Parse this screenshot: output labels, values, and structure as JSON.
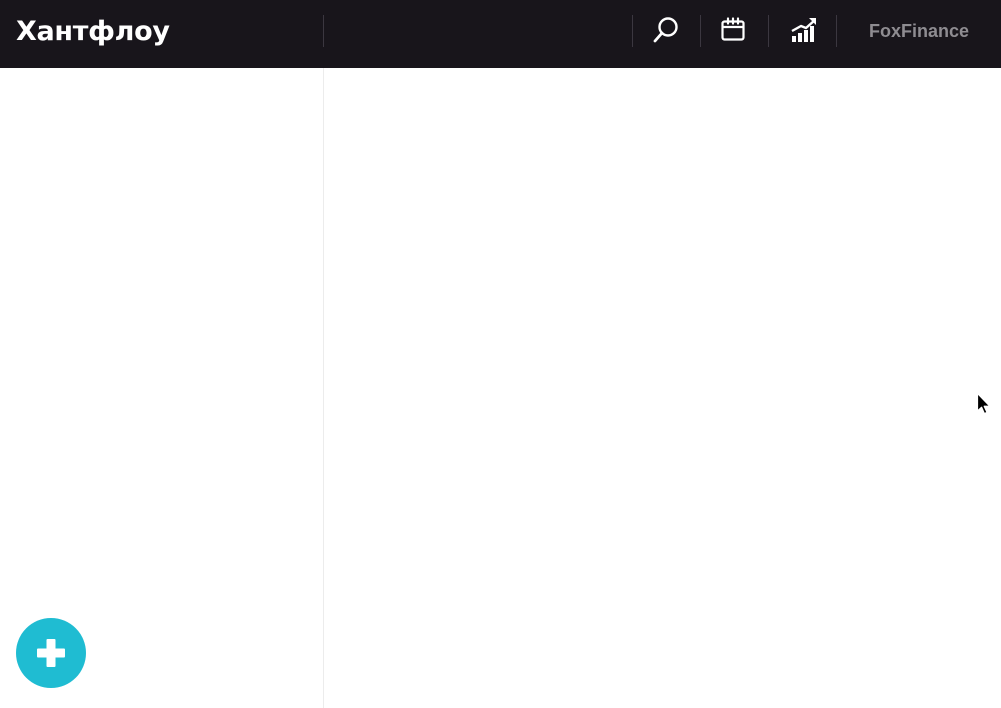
{
  "header": {
    "logo": "Хантфлоу",
    "account_name": "FoxFinance",
    "icons": {
      "search": "search-icon",
      "calendar": "calendar-icon",
      "analytics": "analytics-icon"
    }
  },
  "fab": {
    "icon": "plus-icon"
  },
  "colors": {
    "topbar": "#18151b",
    "accent": "#1fbcd2",
    "account_text": "#8e8c91"
  }
}
